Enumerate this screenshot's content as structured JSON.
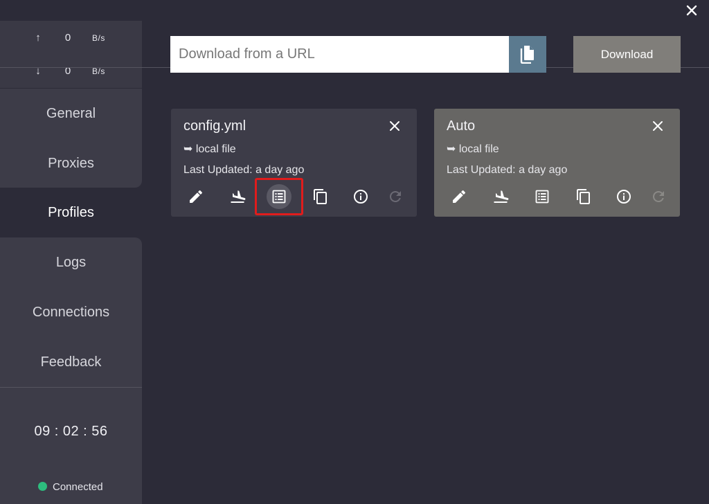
{
  "window": {
    "close_icon": "close-icon"
  },
  "traffic": {
    "upload": {
      "arrow": "↑",
      "value": "0",
      "unit": "B/s"
    },
    "download": {
      "arrow": "↓",
      "value": "0",
      "unit": "B/s"
    }
  },
  "nav": {
    "items": [
      {
        "label": "General"
      },
      {
        "label": "Proxies"
      },
      {
        "label": "Profiles",
        "active": true
      },
      {
        "label": "Logs"
      },
      {
        "label": "Connections"
      },
      {
        "label": "Feedback"
      }
    ]
  },
  "footer": {
    "clock": "09 : 02 : 56",
    "status": "Connected",
    "status_color": "#2dbd7e"
  },
  "url_bar": {
    "placeholder": "Download from a URL",
    "value": "",
    "paste_icon": "paste-icon",
    "download_label": "Download"
  },
  "profiles": [
    {
      "name": "config.yml",
      "source": "➥ local file",
      "updated": "Last Updated: a day ago",
      "selected": false
    },
    {
      "name": "Auto",
      "source": "➥ local file",
      "updated": "Last Updated: a day ago",
      "selected": true
    }
  ],
  "card_actions": [
    "edit-icon",
    "airplane-landing-icon",
    "list-icon",
    "copy-icon",
    "info-icon",
    "refresh-icon"
  ],
  "colors": {
    "background": "#2c2b38",
    "sidebar_panel": "#3d3c48",
    "selected_card": "#676664",
    "paste_button": "#5b7a8f",
    "download_button": "#807e7a",
    "highlight": "#e01c1c"
  }
}
